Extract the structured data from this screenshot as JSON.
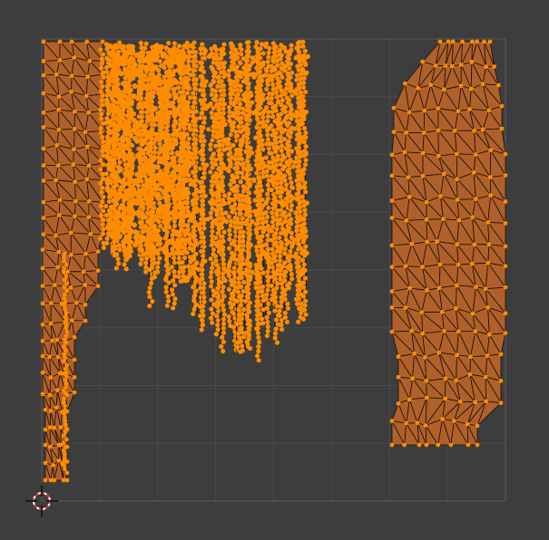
{
  "editor": {
    "view": "uv-editor",
    "background_color": "#3d3d3d",
    "grid_line_color": "#4a4a4a",
    "grid_border_color": "#5a5a5a",
    "uv_face_color": "#b0602b",
    "uv_edge_color": "#1a1007",
    "uv_vertex_color": "#ff8c00",
    "cursor_color": "#ff3333",
    "cursor_name": "2d-cursor-icon"
  }
}
